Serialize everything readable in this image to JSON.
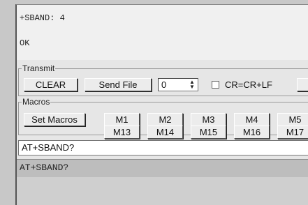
{
  "terminal": {
    "lines": [
      "+SBAND: 4",
      "OK"
    ]
  },
  "transmit": {
    "legend": "Transmit",
    "clear_label": "CLEAR",
    "send_file_label": "Send File",
    "spin_value": "0",
    "crlf_label": "CR=CR+LF",
    "crlf_checked": false
  },
  "macros": {
    "legend": "Macros",
    "set_macros_label": "Set Macros",
    "row1": [
      "M1",
      "M2",
      "M3",
      "M4",
      "M5"
    ],
    "row2": [
      "M13",
      "M14",
      "M15",
      "M16",
      "M17"
    ]
  },
  "command_input": {
    "value": "AT+SBAND?"
  },
  "status_line": "AT+SBAND?"
}
